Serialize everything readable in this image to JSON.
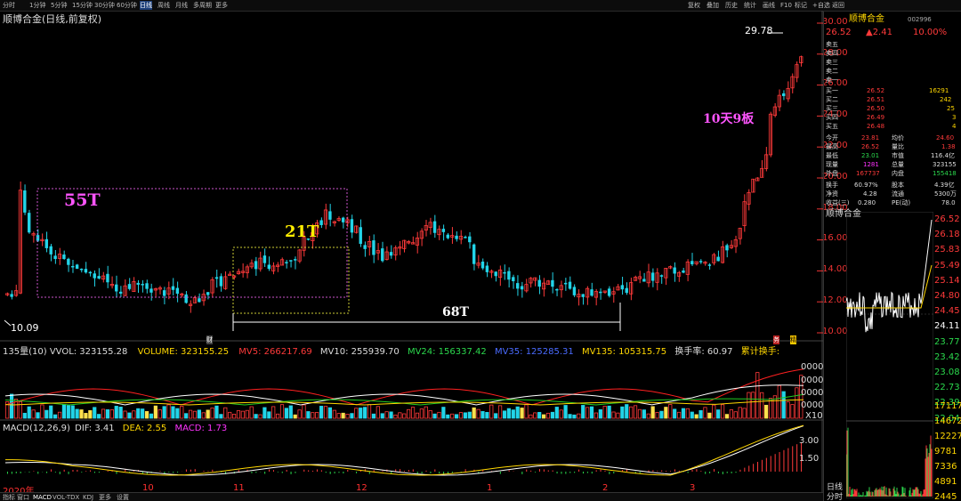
{
  "toolbar": {
    "periods": [
      "分时",
      "1分钟",
      "5分钟",
      "15分钟",
      "30分钟",
      "60分钟",
      "日线",
      "周线",
      "月线",
      "多周期",
      "更多"
    ],
    "active_period": "日线",
    "tools": [
      "复权",
      "叠加",
      "历史",
      "统计",
      "画线",
      "F10",
      "标记",
      "+自选",
      "返回"
    ]
  },
  "chart": {
    "title": "顺博合金(日线,前复权)",
    "price_labels": [
      "30.00",
      "28.00",
      "26.00",
      "24.00",
      "22.00",
      "20.00",
      "18.00",
      "16.00",
      "14.00",
      "12.00",
      "10.00"
    ],
    "high_mark": "29.78",
    "low_mark": "10.09",
    "annotations": {
      "t55": "55T",
      "t21": "21T",
      "t68": "68T",
      "streak": "10天9板"
    },
    "month_labels": [
      "2020年",
      "10",
      "11",
      "12",
      "1",
      "2",
      "3"
    ],
    "event_marks": [
      "财",
      "务",
      "精"
    ]
  },
  "volume_indicator": {
    "name": "135量(10)",
    "vvol": "VVOL: 323155.28",
    "volume": "VOLUME: 323155.25",
    "mv5": "MV5: 266217.69",
    "mv10": "MV10: 255939.70",
    "mv24": "MV24: 156337.42",
    "mv35": "MV35: 125285.31",
    "mv135": "MV135: 105315.75",
    "turnover": "换手率: 60.97",
    "cum_turnover": "累计换手:",
    "axis": [
      "0000",
      "0000",
      "0000",
      "0000",
      "X10"
    ]
  },
  "macd_indicator": {
    "name": "MACD(12,26,9)",
    "dif": "DIF: 3.41",
    "dea": "DEA: 2.55",
    "macd": "MACD: 1.73",
    "axis": [
      "3.00",
      "1.50"
    ]
  },
  "bottom_tabs": [
    "指标",
    "窗口",
    "MACD",
    "VOL-TDX",
    "KDJ",
    "更多",
    "设置"
  ],
  "right_panel": {
    "name": "顺博合金",
    "code": "002996",
    "price": "26.52",
    "change": "▲2.41",
    "pct": "10.00%",
    "asks": [
      "卖五",
      "卖四",
      "卖三",
      "卖二",
      "卖一"
    ],
    "bids": [
      {
        "label": "买一",
        "price": "26.52",
        "vol": "16291"
      },
      {
        "label": "买二",
        "price": "26.51",
        "vol": "242"
      },
      {
        "label": "买三",
        "price": "26.50",
        "vol": "25"
      },
      {
        "label": "买四",
        "price": "26.49",
        "vol": "3"
      },
      {
        "label": "买五",
        "price": "26.48",
        "vol": "4"
      }
    ],
    "stats": [
      {
        "l1": "今开",
        "v1": "23.81",
        "l2": "均价",
        "v2": "24.60"
      },
      {
        "l1": "最高",
        "v1": "26.52",
        "l2": "量比",
        "v2": "1.38"
      },
      {
        "l1": "最低",
        "v1": "23.01",
        "l2": "市值",
        "v2": "116.4亿"
      },
      {
        "l1": "现量",
        "v1": "1281",
        "l2": "总量",
        "v2": "323155"
      },
      {
        "l1": "外盘",
        "v1": "167737",
        "l2": "内盘",
        "v2": "155418"
      }
    ],
    "fin": [
      {
        "l1": "换手",
        "v1": "60.97%",
        "l2": "股本",
        "v2": "4.39亿"
      },
      {
        "l1": "净资",
        "v1": "4.28",
        "l2": "流通",
        "v2": "5300万"
      },
      {
        "l1": "收益(三)",
        "v1": "0.280",
        "l2": "PE(动)",
        "v2": "78.0"
      }
    ],
    "mini_name": "顺博合金",
    "mini_prices": [
      "26.52",
      "26.18",
      "25.83",
      "25.49",
      "25.14",
      "24.80",
      "24.45",
      "24.11",
      "23.77",
      "23.42",
      "23.08",
      "22.73",
      "22.39",
      "22.04"
    ],
    "mini_vols": [
      "17117",
      "14672",
      "12227",
      "9781",
      "7336",
      "4891",
      "2445"
    ],
    "day_tab": "日线",
    "minute_tab": "分时"
  },
  "colors": {
    "up": "#ff3a3a",
    "down": "#22d4e8",
    "mv5": "#ff2020",
    "mv10": "#ffffff",
    "mv24": "#22cc22",
    "mv35": "#3366ff",
    "mv135": "#ffd700"
  }
}
